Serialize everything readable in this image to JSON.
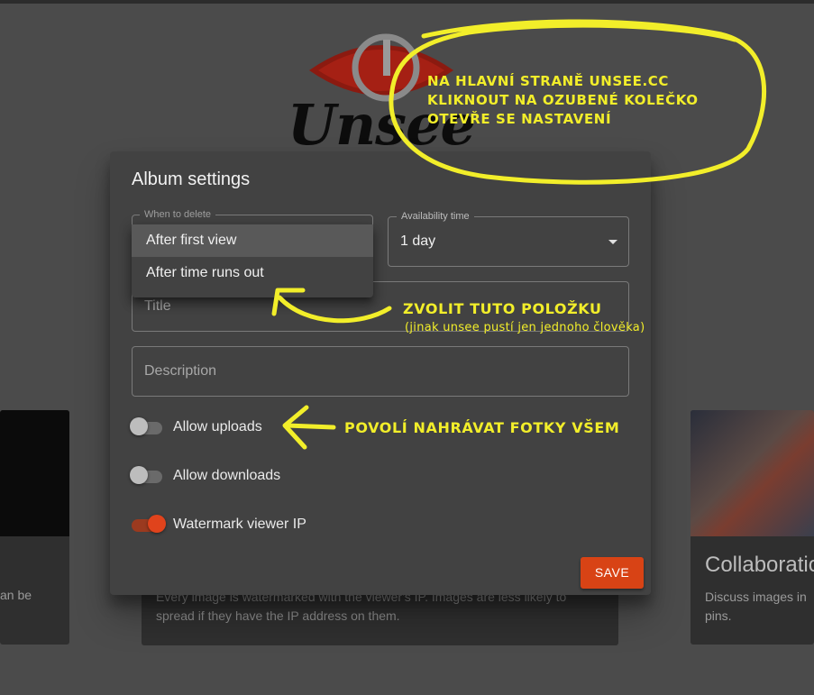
{
  "logo": {
    "text": "Unsee"
  },
  "background_cards": {
    "left": {
      "description": "an be"
    },
    "middle": {
      "description": "Every image is watermarked with the viewer's IP. Images are less likely to spread if they have the IP address on them."
    },
    "right": {
      "title": "Collaboration",
      "description": "Discuss images in pins."
    }
  },
  "dialog": {
    "title": "Album settings",
    "when_to_delete": {
      "label": "When to delete",
      "options": [
        "After first view",
        "After time runs out"
      ],
      "highlighted": "After first view"
    },
    "availability": {
      "label": "Availability time",
      "value": "1 day"
    },
    "title_field": {
      "placeholder": "Title"
    },
    "description_field": {
      "placeholder": "Description"
    },
    "toggles": [
      {
        "label": "Allow uploads",
        "on": false
      },
      {
        "label": "Allow downloads",
        "on": false
      },
      {
        "label": "Watermark viewer IP",
        "on": true
      }
    ],
    "save_label": "SAVE"
  },
  "annotations": {
    "note_1": [
      "NA HLAVNÍ STRANĚ UNSEE.CC",
      "KLIKNOUT NA OZUBENÉ KOLEČKO",
      "OTEVŘE SE NASTAVENÍ"
    ],
    "note_2": "ZVOLIT TUTO POLOŽKU",
    "note_2_sub": "(jinak unsee pustí jen jednoho člověka)",
    "note_3": "POVOLÍ NAHRÁVAT FOTKY VŠEM"
  },
  "colors": {
    "accent": "#d84315",
    "annotation": "#f2ee2a",
    "logo_red": "#8b1a10"
  }
}
